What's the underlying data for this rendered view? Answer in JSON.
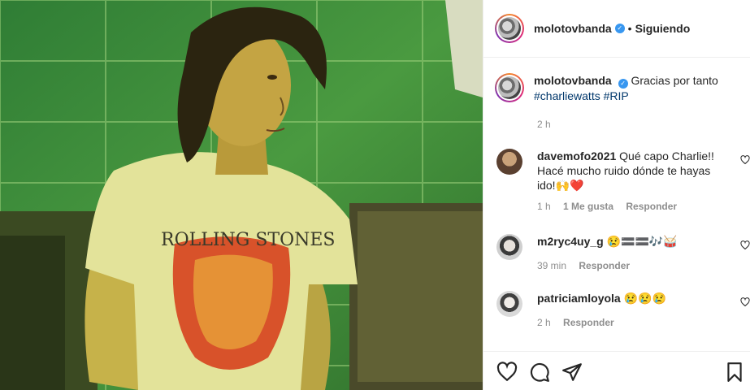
{
  "post": {
    "image_alt": "Photo of man in Rolling Stones t-shirt",
    "shirt_text": "ROLLING STONES"
  },
  "header": {
    "username": "molotovbanda",
    "separator": "•",
    "follow_status": "Siguiendo"
  },
  "caption": {
    "username": "molotovbanda",
    "text": "Gracias por tanto",
    "hashtags": [
      "#charliewatts",
      "#RIP"
    ],
    "time": "2 h"
  },
  "comments": [
    {
      "username": "davemofo2021",
      "text": "Qué capo Charlie!! Hacé mucho ruido dónde te hayas ido!🙌❤️",
      "time": "1 h",
      "likes": "1 Me gusta",
      "reply": "Responder"
    },
    {
      "username": "m2ryc4uy_g",
      "text": "😢🟰🟰🎶🥁",
      "time": "39 min",
      "reply": "Responder"
    },
    {
      "username": "patriciamloyola",
      "text": "😢😢😢",
      "time": "2 h",
      "reply": "Responder"
    }
  ],
  "icons": {
    "verified": "verified-badge-icon",
    "like": "heart-icon",
    "comment": "comment-icon",
    "share": "paper-plane-icon",
    "save": "bookmark-icon"
  },
  "colors": {
    "accent": "#3897f0",
    "hashtag": "#00376b",
    "muted": "#8e8e8e"
  }
}
